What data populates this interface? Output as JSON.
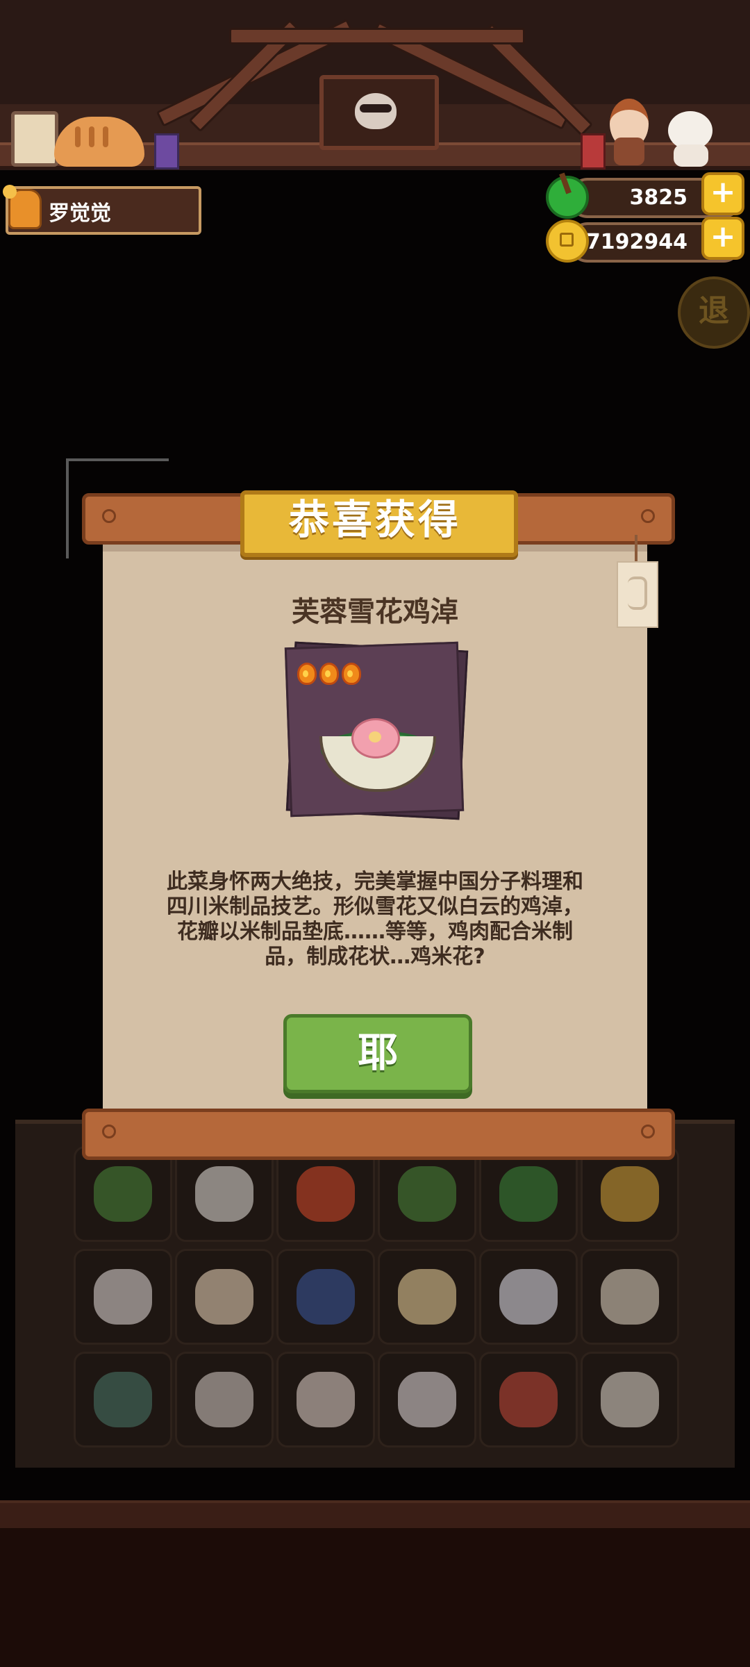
{
  "header": {
    "player_name": "罗觉觉",
    "gems": "3825",
    "coins": "87192944",
    "plus_label": "+",
    "exit_label": "退"
  },
  "dialog": {
    "title": "恭喜获得",
    "dish_name": "芙蓉雪花鸡淖",
    "heat_level": 3,
    "description": "此菜身怀两大绝技，完美掌握中国分子料理和四川米制品技艺。形似雪花又似白云的鸡淖，花瓣以米制品垫底……等等，鸡肉配合米制品，制成花状…鸡米花?",
    "confirm_label": "耶"
  },
  "ingredients": [
    {
      "name": "green-onion",
      "color": "#4a8a3a"
    },
    {
      "name": "tofu",
      "color": "#e8e4dc"
    },
    {
      "name": "tomato",
      "color": "#d84a2a"
    },
    {
      "name": "cucumber",
      "color": "#4a8a3a"
    },
    {
      "name": "green-pepper",
      "color": "#3a8a3a"
    },
    {
      "name": "potato",
      "color": "#d8a83a"
    },
    {
      "name": "chicken",
      "color": "#e8e0dc"
    },
    {
      "name": "egg",
      "color": "#f2dcc0"
    },
    {
      "name": "blue-fish",
      "color": "#3a5aa0"
    },
    {
      "name": "rice-cake",
      "color": "#f2d8a0"
    },
    {
      "name": "rice-bowl",
      "color": "#e8e8f0"
    },
    {
      "name": "jar",
      "color": "#e8dcc8"
    },
    {
      "name": "crab",
      "color": "#4a7a6a"
    },
    {
      "name": "shrimp",
      "color": "#d8d0c8"
    },
    {
      "name": "duck",
      "color": "#e8d8d0"
    },
    {
      "name": "squid",
      "color": "#e8e0e0"
    },
    {
      "name": "meat",
      "color": "#c84a3a"
    },
    {
      "name": "clam",
      "color": "#e8e0d4"
    }
  ]
}
